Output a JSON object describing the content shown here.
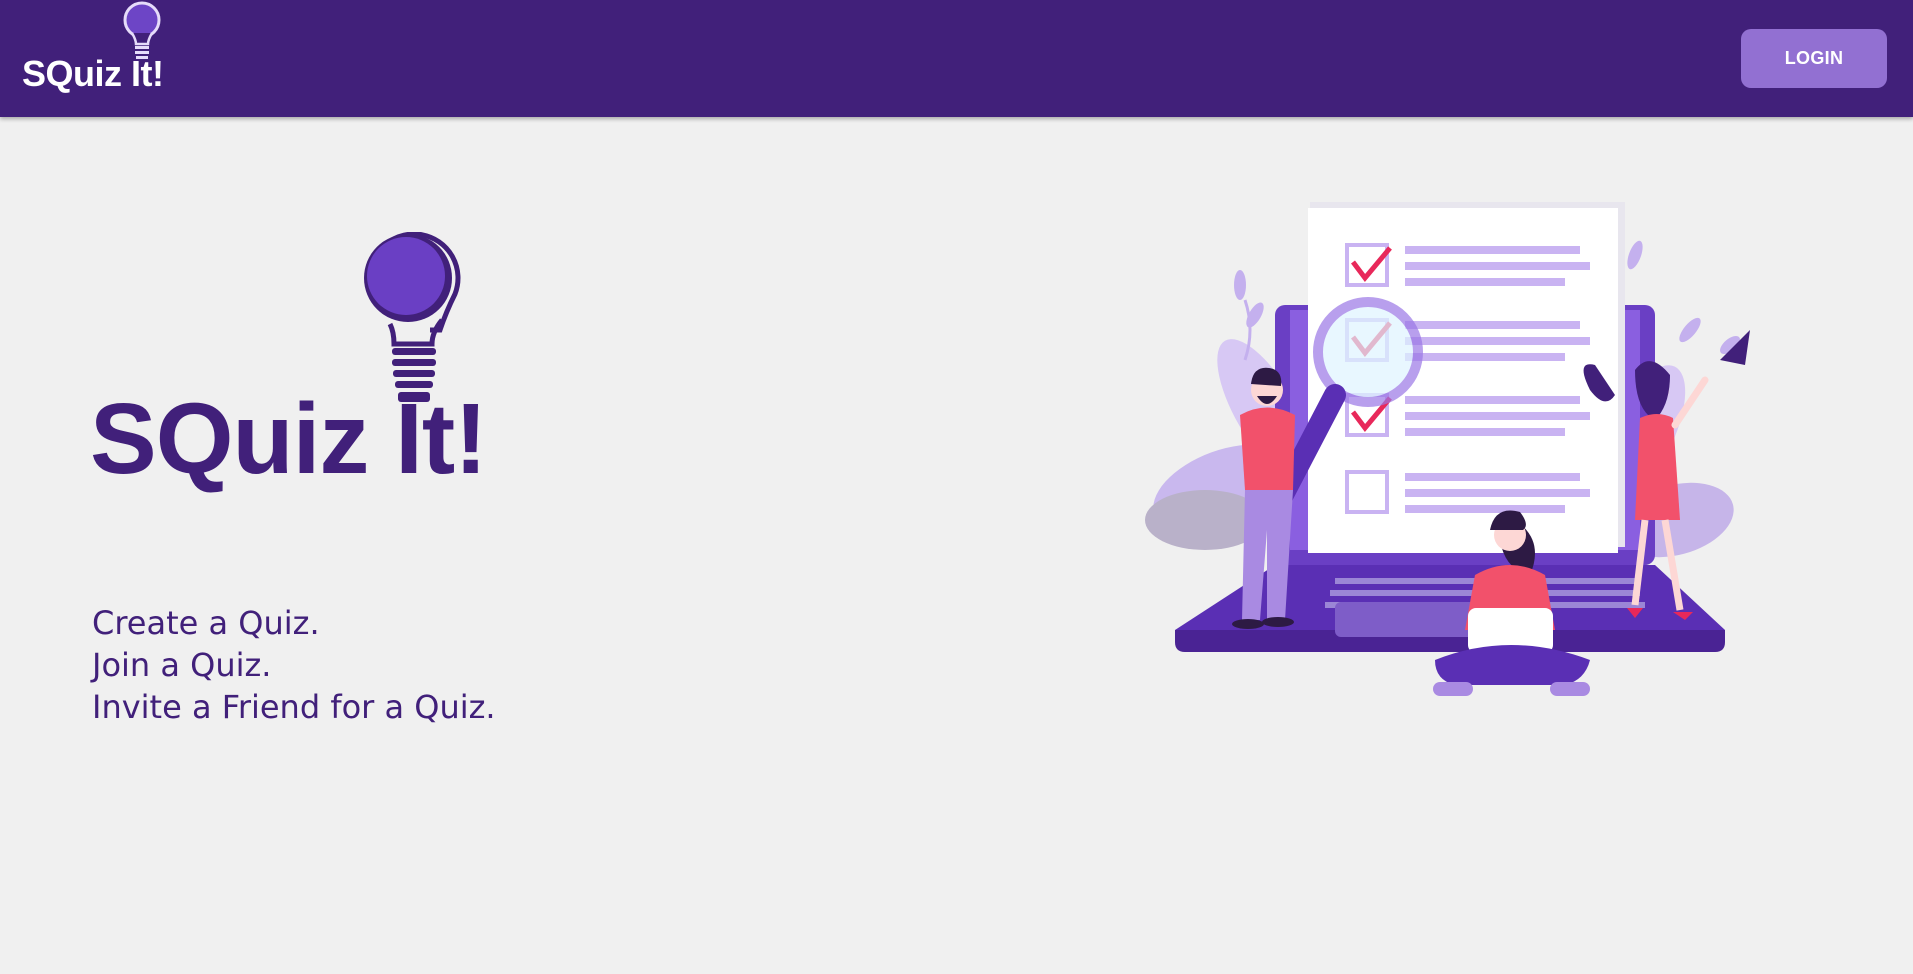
{
  "header": {
    "brand_text": "SQuiz It!",
    "brand_icon": "lightbulb-icon",
    "login_label": "LOGIN"
  },
  "hero": {
    "title": "SQuiz It!",
    "logo_icon": "lightbulb-icon",
    "taglines": [
      "Create a Quiz.",
      "Join a Quiz.",
      "Invite a Friend for a Quiz."
    ]
  },
  "illustration": {
    "name": "quiz-checklist-illustration",
    "checkbox_states": [
      true,
      true,
      true,
      false
    ]
  },
  "colors": {
    "appbar": "#41207a",
    "button": "#9270d2",
    "brand_text": "#41207a",
    "background": "#f0f0f0",
    "accent_red": "#ef3c5d"
  }
}
